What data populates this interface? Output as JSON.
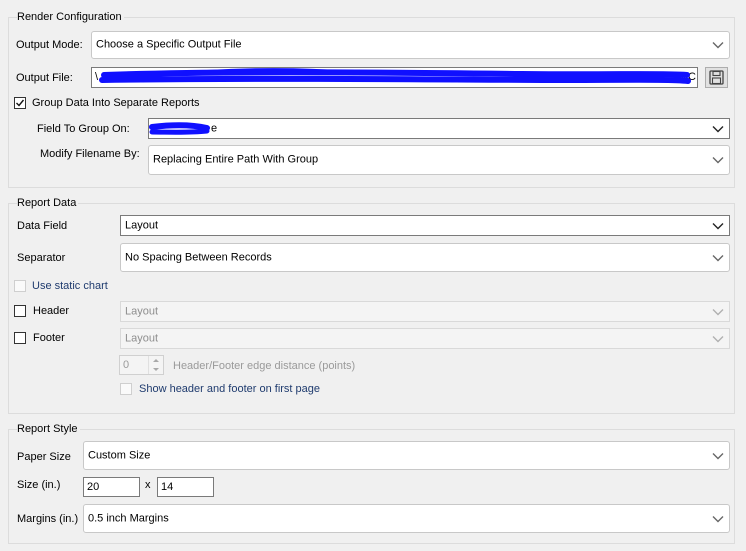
{
  "render": {
    "title": "Render Configuration",
    "output_mode_label": "Output Mode:",
    "output_mode_value": "Choose a Specific Output File",
    "output_file_label": "Output File:",
    "output_file_value_start": "\\",
    "output_file_value_end": "MC",
    "save_icon": "floppy-save-icon",
    "group_checkbox_label": "Group Data Into Separate Reports",
    "group_checked": true,
    "field_group_label": "Field To Group On:",
    "field_group_value_suffix": "e",
    "modify_label": "Modify Filename By:",
    "modify_value": "Replacing Entire Path With Group"
  },
  "report_data": {
    "title": "Report Data",
    "data_field_label": "Data Field",
    "data_field_value": "Layout",
    "separator_label": "Separator",
    "separator_value": "No Spacing Between Records",
    "static_chart_label": "Use static chart",
    "header_label": "Header",
    "header_value": "Layout",
    "footer_label": "Footer",
    "footer_value": "Layout",
    "edge_distance_value": "0",
    "edge_distance_label": "Header/Footer edge distance (points)",
    "first_page_label": "Show header and footer on first page"
  },
  "report_style": {
    "title": "Report Style",
    "paper_size_label": "Paper Size",
    "paper_size_value": "Custom Size",
    "size_label": "Size (in.)",
    "size_width": "20",
    "size_x": "x",
    "size_height": "14",
    "margins_label": "Margins (in.)",
    "margins_value": "0.5 inch Margins"
  },
  "colors": {
    "redaction": "#1010ff",
    "link_text": "#1f3b6e"
  }
}
